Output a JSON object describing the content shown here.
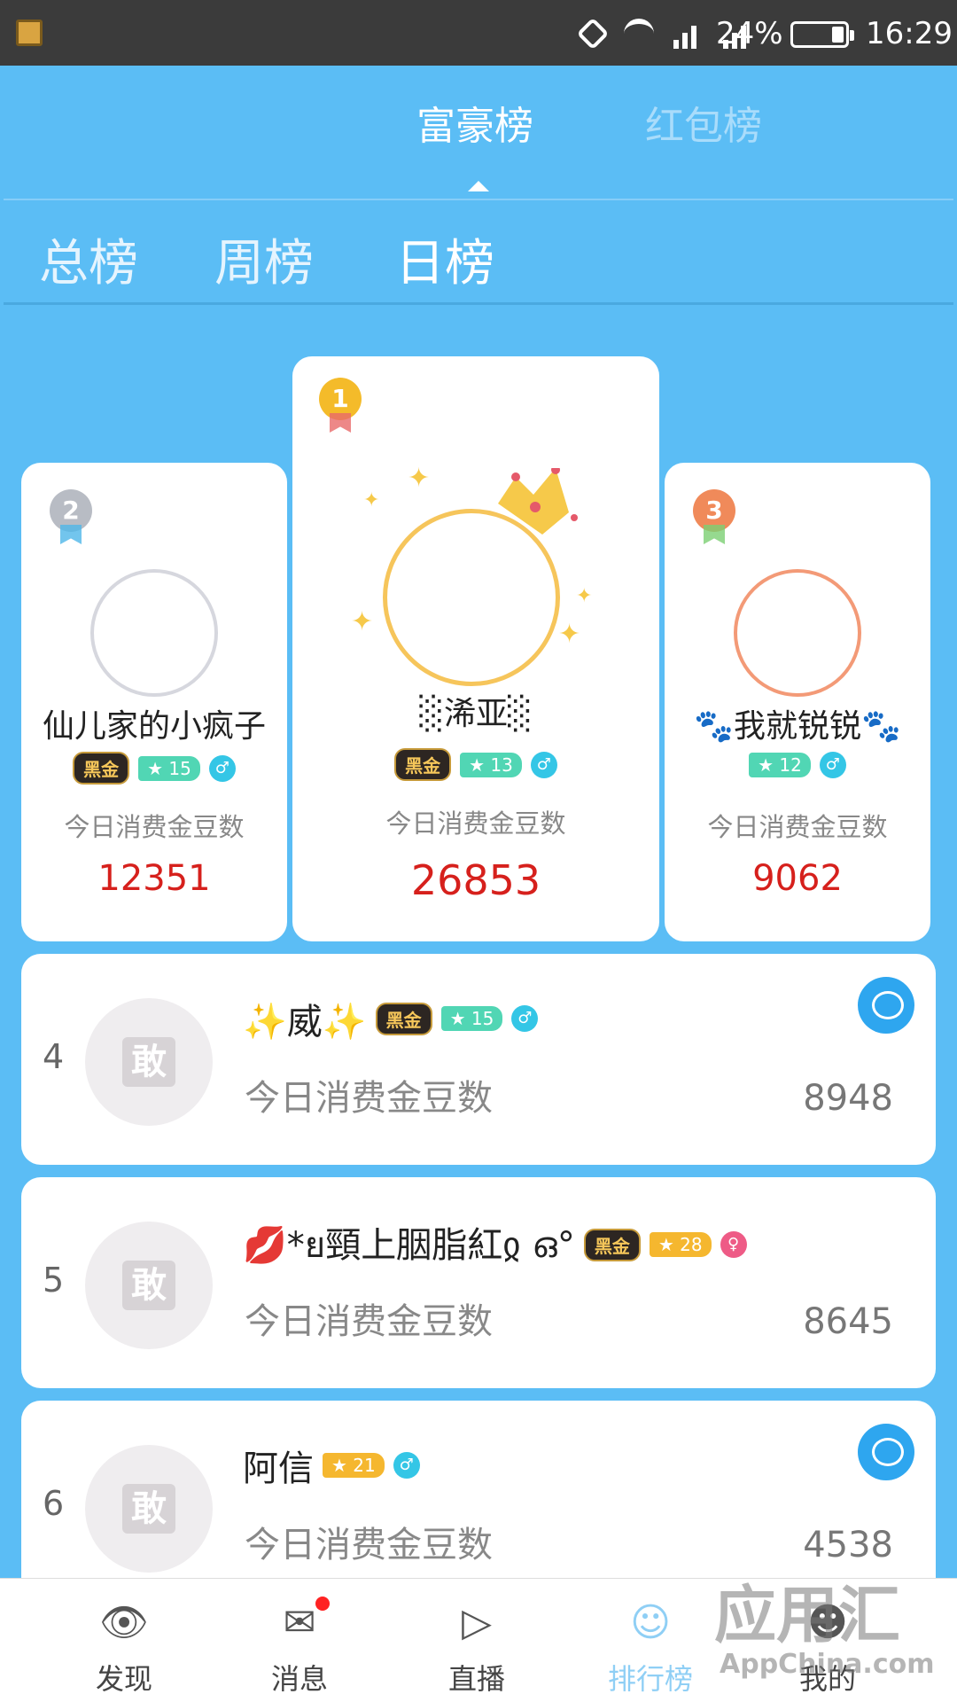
{
  "status_bar": {
    "battery": "24%",
    "battery_level": 0.24,
    "time": "16:29"
  },
  "top_tabs": [
    {
      "label": "富豪榜",
      "active": true
    },
    {
      "label": "红包榜",
      "active": false
    }
  ],
  "sub_tabs": [
    {
      "label": "总榜"
    },
    {
      "label": "周榜"
    },
    {
      "label": "日榜",
      "active": true
    }
  ],
  "podium": {
    "first": {
      "rank": "1",
      "name": "░浠亚░",
      "vip": "黑金",
      "level": "13",
      "gender": "male",
      "label": "今日消费金豆数",
      "amount": "26853"
    },
    "second": {
      "rank": "2",
      "name": "仙儿家的小疯子",
      "vip": "黑金",
      "level": "15",
      "gender": "male",
      "label": "今日消费金豆数",
      "amount": "12351"
    },
    "third": {
      "rank": "3",
      "name": "🐾我就锐锐🐾",
      "level": "12",
      "gender": "male",
      "label": "今日消费金豆数",
      "amount": "9062"
    }
  },
  "list": [
    {
      "rank": "4",
      "name": "✨威✨",
      "vip": "黑金",
      "level": "15",
      "gender": "male",
      "label": "今日消费金豆数",
      "amount": "8948"
    },
    {
      "rank": "5",
      "name": "💋*ย頸上胭脂紅ჲ ഒ°",
      "vip": "黑金",
      "level": "28",
      "gender": "female",
      "label": "今日消费金豆数",
      "amount": "8645"
    },
    {
      "rank": "6",
      "name": "阿信",
      "level": "21",
      "gender": "male",
      "label": "今日消费金豆数",
      "amount": "4538"
    }
  ],
  "nav": [
    {
      "label": "发现",
      "icon": "eye-icon"
    },
    {
      "label": "消息",
      "icon": "message-icon"
    },
    {
      "label": "直播",
      "icon": "video-icon"
    },
    {
      "label": "排行榜",
      "icon": "ranking-icon",
      "active": true
    },
    {
      "label": "我的",
      "icon": "profile-icon"
    }
  ],
  "watermark": {
    "title": "应用汇",
    "sub": "AppChina.com"
  },
  "colors": {
    "primary": "#5bbdf5",
    "amount_red": "#d6201c",
    "gold": "#f6c55b"
  }
}
